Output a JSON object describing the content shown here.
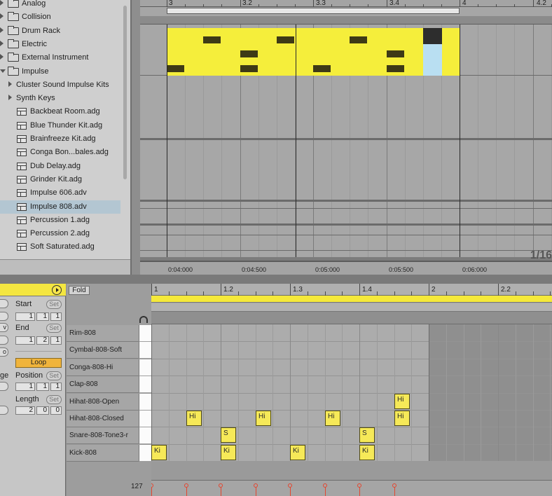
{
  "browser": {
    "items": [
      {
        "label": "Analog",
        "type": "folder",
        "expand": "closed",
        "indent": 0
      },
      {
        "label": "Collision",
        "type": "folder",
        "expand": "closed",
        "indent": 0
      },
      {
        "label": "Drum Rack",
        "type": "folder",
        "expand": "closed",
        "indent": 0
      },
      {
        "label": "Electric",
        "type": "folder",
        "expand": "closed",
        "indent": 0
      },
      {
        "label": "External Instrument",
        "type": "folder",
        "expand": "closed",
        "indent": 0
      },
      {
        "label": "Impulse",
        "type": "folder",
        "expand": "open",
        "indent": 0
      },
      {
        "label": "Cluster Sound Impulse Kits",
        "type": "subfolder",
        "expand": "closed",
        "indent": 1
      },
      {
        "label": "Synth Keys",
        "type": "subfolder",
        "expand": "closed",
        "indent": 1
      },
      {
        "label": "Backbeat Room.adg",
        "type": "rack",
        "indent": 2
      },
      {
        "label": "Blue Thunder Kit.adg",
        "type": "rack",
        "indent": 2
      },
      {
        "label": "Brainfreeze Kit.adg",
        "type": "rack",
        "indent": 2
      },
      {
        "label": "Conga Bon...bales.adg",
        "type": "rack",
        "indent": 2
      },
      {
        "label": "Dub Delay.adg",
        "type": "rack",
        "indent": 2
      },
      {
        "label": "Grinder Kit.adg",
        "type": "rack",
        "indent": 2
      },
      {
        "label": "Impulse 606.adv",
        "type": "rack",
        "indent": 2
      },
      {
        "label": "Impulse 808.adv",
        "type": "rack",
        "indent": 2,
        "selected": true
      },
      {
        "label": "Percussion 1.adg",
        "type": "rack",
        "indent": 2
      },
      {
        "label": "Percussion 2.adg",
        "type": "rack",
        "indent": 2
      },
      {
        "label": "Soft Saturated.adg",
        "type": "rack",
        "indent": 2
      }
    ]
  },
  "arrangement": {
    "bar_labels": [
      "3",
      "3.2",
      "3.3",
      "3.4",
      "4",
      "4.2"
    ],
    "time_labels": [
      "0:04:000",
      "0:04:500",
      "0:05:000",
      "0:05:500",
      "0:06:000"
    ],
    "zoom": "1/16",
    "clip_color": "#f5ee3b"
  },
  "clip_panel": {
    "start_label": "Start",
    "end_label": "End",
    "loop_label": "Loop",
    "position_label": "Position",
    "length_label": "Length",
    "set_label": "Set",
    "start_values": [
      "1",
      "1",
      "1"
    ],
    "end_values": [
      "1",
      "2",
      "1"
    ],
    "position_values": [
      "1",
      "1",
      "1"
    ],
    "length_values": [
      "2",
      "0",
      "0"
    ],
    "edge_partial": [
      "ge"
    ],
    "edge_chars": [
      "v",
      "o"
    ]
  },
  "midi_editor": {
    "fold_label": "Fold",
    "bar_labels": [
      "1",
      "1.2",
      "1.3",
      "1.4",
      "2",
      "2.2"
    ],
    "velocity_max": "127",
    "pads": [
      "Rim-808",
      "Cymbal-808-Soft",
      "Conga-808-Hi",
      "Clap-808",
      "Hihat-808-Open",
      "Hihat-808-Closed",
      "Snare-808-Tone3-r",
      "Kick-808"
    ],
    "notes": [
      {
        "row": 7,
        "step": 0,
        "label": "Ki"
      },
      {
        "row": 5,
        "step": 2,
        "label": "Hi"
      },
      {
        "row": 6,
        "step": 4,
        "label": "S"
      },
      {
        "row": 7,
        "step": 4,
        "label": "Ki"
      },
      {
        "row": 5,
        "step": 6,
        "label": "Hi"
      },
      {
        "row": 7,
        "step": 8,
        "label": "Ki"
      },
      {
        "row": 5,
        "step": 10,
        "label": "Hi"
      },
      {
        "row": 6,
        "step": 12,
        "label": "S"
      },
      {
        "row": 7,
        "step": 12,
        "label": "Ki"
      },
      {
        "row": 4,
        "step": 14,
        "label": "Hi"
      },
      {
        "row": 5,
        "step": 14,
        "label": "Hi"
      }
    ],
    "note_color": "#f6e958",
    "velocity_color": "#e4452e"
  }
}
